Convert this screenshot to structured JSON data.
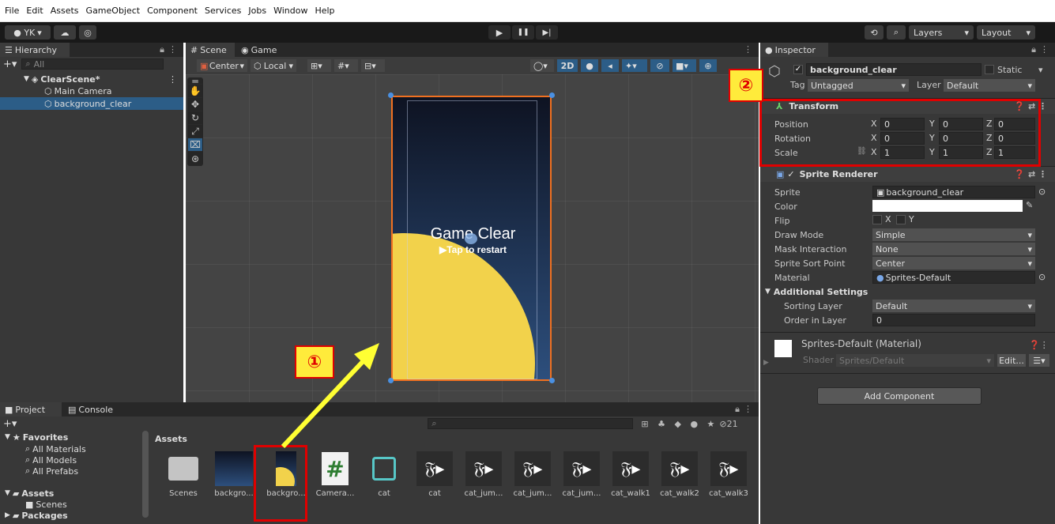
{
  "menu": [
    "File",
    "Edit",
    "Assets",
    "GameObject",
    "Component",
    "Services",
    "Jobs",
    "Window",
    "Help"
  ],
  "toolbar": {
    "account": "YK",
    "account_caret": "▾",
    "play": "▶",
    "pause": "❚❚",
    "step": "▶|",
    "layers_label": "Layers",
    "layout_label": "Layout"
  },
  "hierarchy": {
    "tab": "Hierarchy",
    "search_placeholder": "All",
    "scene": "ClearScene*",
    "items": [
      "Main Camera",
      "background_clear"
    ]
  },
  "scene_view": {
    "tabs": [
      "Scene",
      "Game"
    ],
    "pivot": "Center",
    "space": "Local",
    "mode_2d": "2D",
    "game_title": "Game Clear",
    "game_subtitle": "▶Tap to restart"
  },
  "inspector": {
    "tab": "Inspector",
    "object_name": "background_clear",
    "static_label": "Static",
    "tag_label": "Tag",
    "tag_value": "Untagged",
    "layer_label": "Layer",
    "layer_value": "Default",
    "transform": {
      "title": "Transform",
      "position_label": "Position",
      "rotation_label": "Rotation",
      "scale_label": "Scale",
      "position": [
        "0",
        "0",
        "0"
      ],
      "rotation": [
        "0",
        "0",
        "0"
      ],
      "scale": [
        "1",
        "1",
        "1"
      ],
      "x": "X",
      "y": "Y",
      "z": "Z"
    },
    "sprite_renderer": {
      "title": "Sprite Renderer",
      "sprite_label": "Sprite",
      "sprite_value": "background_clear",
      "color_label": "Color",
      "flip_label": "Flip",
      "flip_x": "X",
      "flip_y": "Y",
      "draw_mode_label": "Draw Mode",
      "draw_mode_value": "Simple",
      "mask_label": "Mask Interaction",
      "mask_value": "None",
      "sort_point_label": "Sprite Sort Point",
      "sort_point_value": "Center",
      "material_label": "Material",
      "material_value": "Sprites-Default",
      "additional_label": "Additional Settings",
      "sorting_layer_label": "Sorting Layer",
      "sorting_layer_value": "Default",
      "order_label": "Order in Layer",
      "order_value": "0"
    },
    "material": {
      "title": "Sprites-Default (Material)",
      "shader_label": "Shader",
      "shader_value": "Sprites/Default",
      "edit_label": "Edit..."
    },
    "add_component": "Add Component"
  },
  "project": {
    "tabs": [
      "Project",
      "Console"
    ],
    "favorites_label": "Favorites",
    "favorites": [
      "All Materials",
      "All Models",
      "All Prefabs"
    ],
    "assets_label": "Assets",
    "scenes_label": "Scenes",
    "packages_label": "Packages",
    "breadcrumb": "Assets",
    "count": "21",
    "assets": [
      "Scenes",
      "backgro...",
      "backgro...",
      "Camera...",
      "cat",
      "cat",
      "cat_jum...",
      "cat_jum...",
      "cat_jum...",
      "cat_walk1",
      "cat_walk2",
      "cat_walk3"
    ]
  },
  "annotations": {
    "one": "①",
    "two": "②"
  },
  "colors": {
    "highlight": "#e00000",
    "arrow": "#ffff33",
    "selection": "#2c5d87",
    "sun": "#f2d24b",
    "sky_top": "#0e1322",
    "sky_bottom": "#2d4f7d"
  }
}
